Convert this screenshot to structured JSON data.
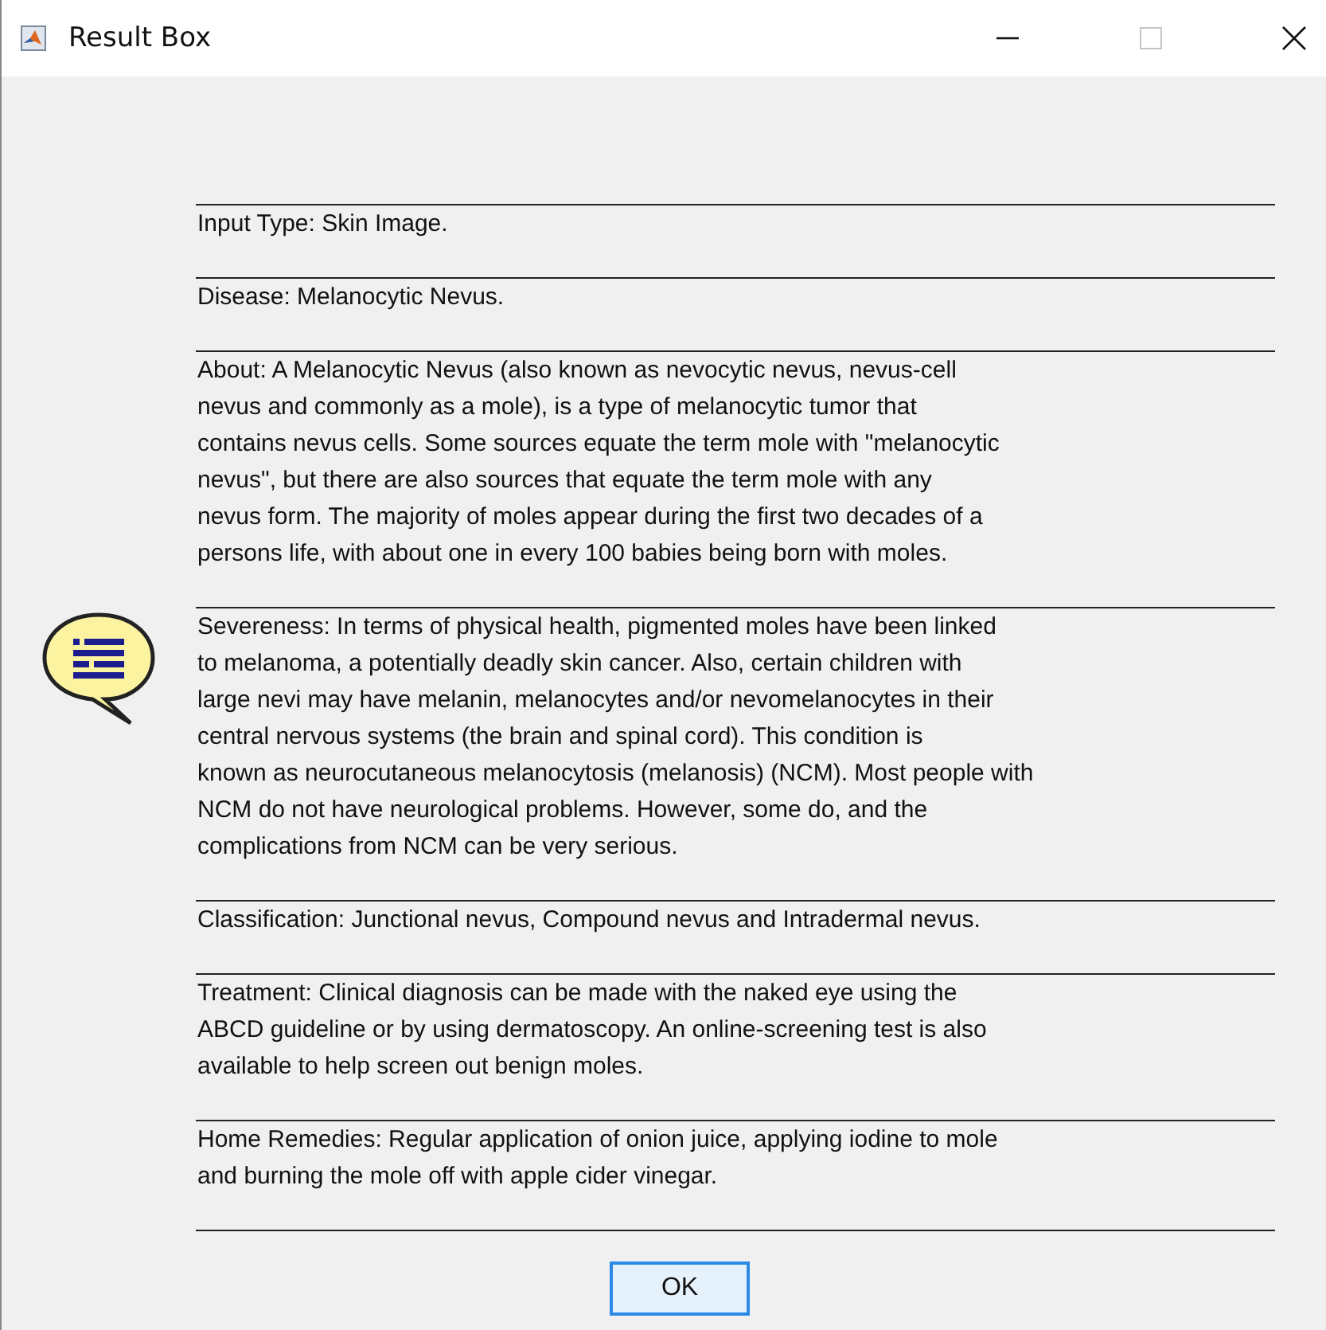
{
  "window": {
    "title": "Result Box"
  },
  "sections": [
    {
      "text": "Input Type: Skin Image."
    },
    {
      "text": "Disease: Melanocytic Nevus."
    },
    {
      "text": "About: A Melanocytic Nevus (also known as nevocytic nevus, nevus-cell\nnevus and commonly as a mole), is a type of melanocytic tumor that\ncontains nevus cells. Some sources equate the term mole with \"melanocytic\nnevus\", but there are also sources that equate the term mole with any\nnevus form. The majority of moles appear during the first two decades of a\npersons life, with about one in every 100 babies being born with moles."
    },
    {
      "text": "Severeness: In terms of physical health, pigmented moles have been linked\nto melanoma, a potentially deadly skin cancer. Also, certain children with\nlarge nevi may have melanin, melanocytes and/or nevomelanocytes in their\ncentral nervous systems (the brain and spinal cord). This condition is\nknown as neurocutaneous melanocytosis (melanosis) (NCM). Most people with\nNCM do not have neurological problems. However, some do, and the\ncomplications from NCM can be very serious."
    },
    {
      "text": "Classification: Junctional nevus, Compound nevus and Intradermal nevus."
    },
    {
      "text": "Treatment: Clinical diagnosis can be made with the naked eye using the\nABCD guideline or by using dermatoscopy. An online-screening test is also\navailable to help screen out benign moles."
    },
    {
      "text": "Home Remedies: Regular application of onion juice, applying iodine to mole\nand burning the mole off with apple cider vinegar."
    }
  ],
  "button": "OK"
}
